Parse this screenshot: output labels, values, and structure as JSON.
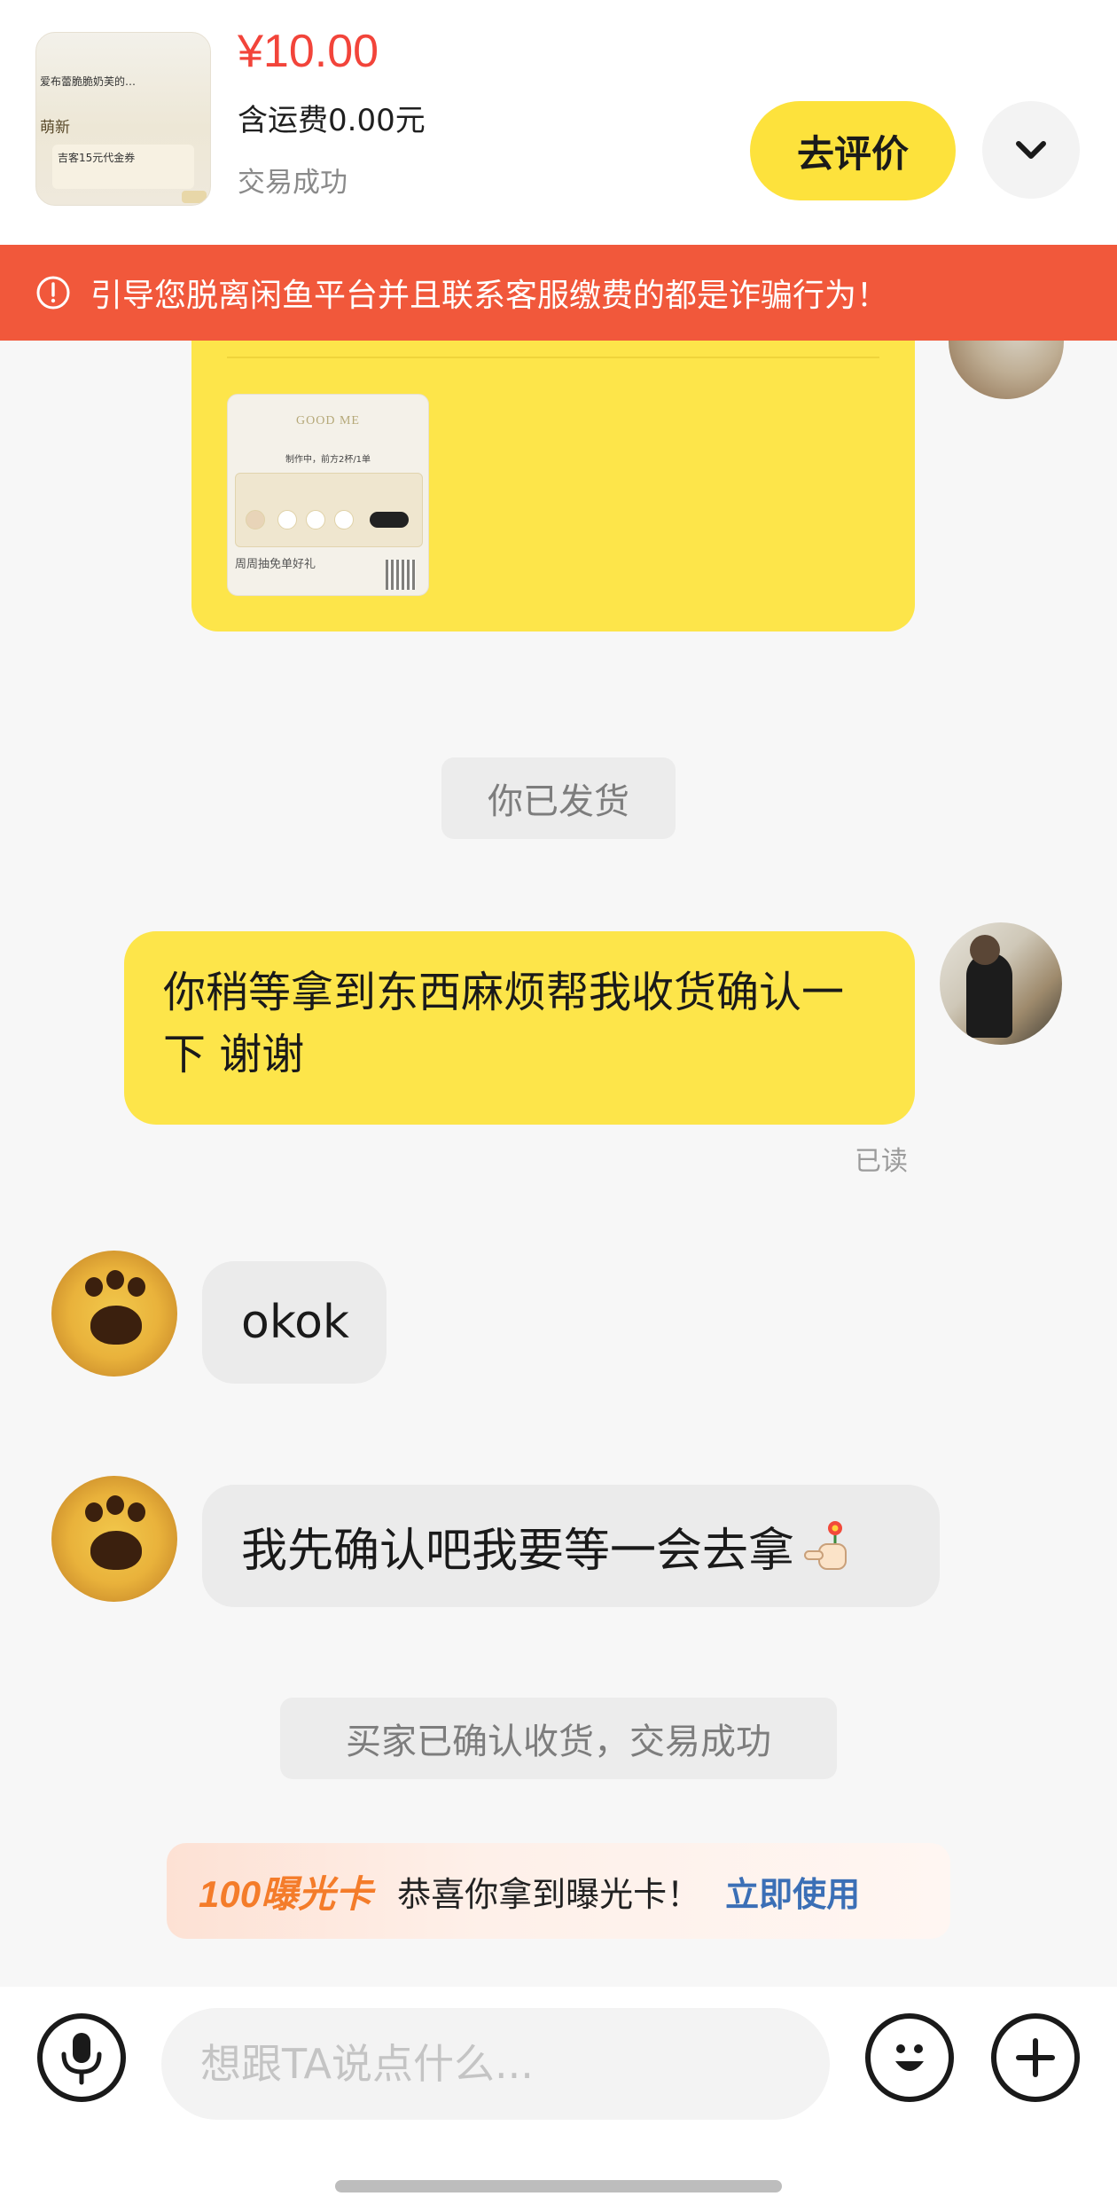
{
  "header": {
    "thumbnail": {
      "line1": "爱布蕾脆脆奶芙的…",
      "line2": "萌新",
      "line3": "吉客15元代金券"
    },
    "price": "¥10.00",
    "shipping": "含运费0.00元",
    "status": "交易成功",
    "review_button": "去评价",
    "expand_icon": "chevron-down-icon"
  },
  "warning": {
    "icon": "alert-circle-icon",
    "text": "引导您脱离闲鱼平台并且联系客服缴费的都是诈骗行为！"
  },
  "card_image": {
    "logo": "GOOD ME",
    "line": "制作中，前方2杯/1单",
    "bottom": "周周抽免单好礼"
  },
  "messages": {
    "system_shipped": "你已发货",
    "self_message": "你稍等拿到东西麻烦帮我收货确认一下 谢谢",
    "read_status": "已读",
    "other_message_1": "okok",
    "other_message_2": "我先确认吧我要等一会去拿",
    "system_confirmed": "买家已确认收货，交易成功"
  },
  "exposure_card": {
    "badge": "100曝光卡",
    "message": "恭喜你拿到曝光卡！",
    "action": "立即使用"
  },
  "input_bar": {
    "placeholder": "想跟TA说点什么...",
    "value": "",
    "icons": [
      "microphone-icon",
      "emoji-icon",
      "plus-icon"
    ]
  },
  "colors": {
    "price": "#f2443a",
    "accent_yellow": "#fde23c",
    "warning_bg": "#f1583b",
    "exposure_orange": "#f47c2a",
    "action_blue": "#3b6fb6"
  }
}
